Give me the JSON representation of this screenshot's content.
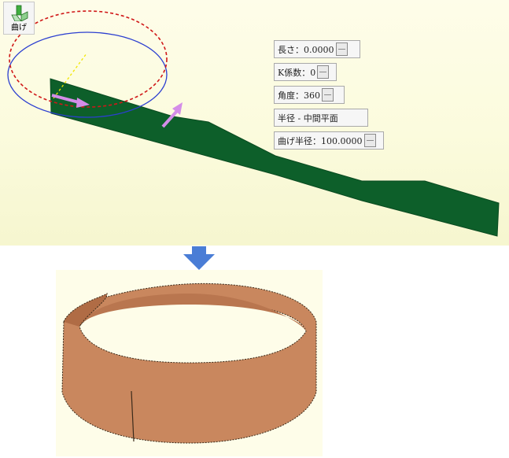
{
  "toolbar": {
    "bend_label": "曲げ",
    "bend_icon": "bend-icon"
  },
  "params": {
    "length": "長さ：0.0000",
    "k_factor": "K係数：0",
    "angle": "角度：360",
    "radius": "半径 - 中間平面",
    "bend_radius": "曲げ半径：100.0000"
  },
  "colors": {
    "strip": "#0d5f2a",
    "ring": "#c9875e",
    "viewport_bg": "#fbfbdd",
    "arrow": "#4a7dd6",
    "drag_arrow": "#d48de8"
  },
  "icons": {
    "flow_arrow": "down-arrow-icon",
    "handle_arrow": "arrow-handle-icon"
  }
}
